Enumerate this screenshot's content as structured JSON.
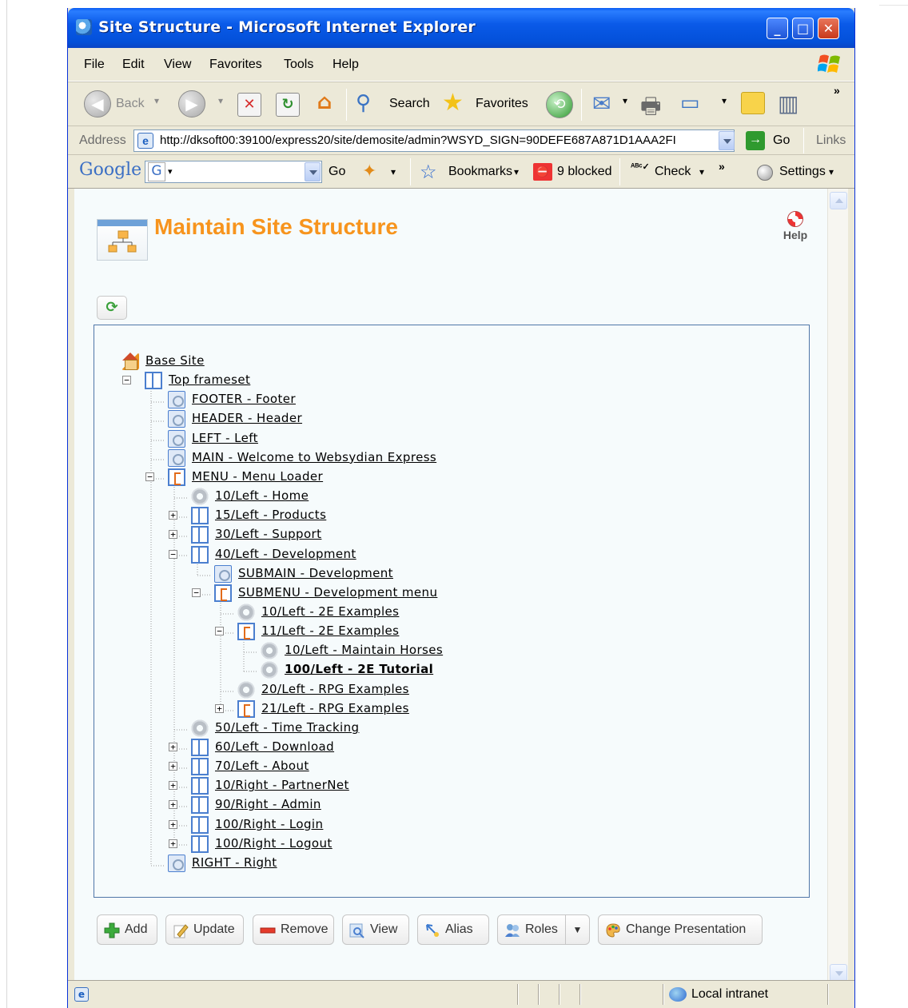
{
  "window": {
    "title": "Site Structure - Microsoft Internet Explorer"
  },
  "menu": [
    "File",
    "Edit",
    "View",
    "Favorites",
    "Tools",
    "Help"
  ],
  "toolbar": {
    "back": "Back",
    "search": "Search",
    "favorites": "Favorites"
  },
  "address": {
    "label": "Address",
    "url": "http://dksoft00:39100/express20/site/demosite/admin?WSYD_SIGN=90DEFE687A871D1AAA2FI",
    "go": "Go",
    "links": "Links"
  },
  "google": {
    "logo": "Google",
    "go": "Go",
    "bookmarks": "Bookmarks",
    "blocked": "9 blocked",
    "check": "Check",
    "settings": "Settings"
  },
  "page": {
    "title": "Maintain Site Structure",
    "help": "Help"
  },
  "tree": [
    {
      "label": "Base Site",
      "icon": "home-icon",
      "depth": 0
    },
    {
      "label": "Top frameset",
      "icon": "frameset-icon",
      "depth": 1,
      "toggle": "−"
    },
    {
      "label": "FOOTER - Footer",
      "icon": "page-icon",
      "depth": 2
    },
    {
      "label": "HEADER - Header",
      "icon": "page-icon",
      "depth": 2
    },
    {
      "label": "LEFT - Left",
      "icon": "page-icon",
      "depth": 2
    },
    {
      "label": "MAIN - Welcome to Websydian Express",
      "icon": "page-icon",
      "depth": 2
    },
    {
      "label": "MENU - Menu Loader",
      "icon": "menu-icon",
      "depth": 2,
      "toggle": "−"
    },
    {
      "label": "10/Left - Home",
      "icon": "gear-icon",
      "depth": 3
    },
    {
      "label": "15/Left - Products",
      "icon": "frameset-icon",
      "depth": 3,
      "toggle": "+"
    },
    {
      "label": "30/Left - Support",
      "icon": "frameset-icon",
      "depth": 3,
      "toggle": "+"
    },
    {
      "label": "40/Left - Development",
      "icon": "frameset-icon",
      "depth": 3,
      "toggle": "−"
    },
    {
      "label": "SUBMAIN - Development",
      "icon": "page-icon",
      "depth": 4
    },
    {
      "label": "SUBMENU - Development menu",
      "icon": "menu-icon",
      "depth": 4,
      "toggle": "−"
    },
    {
      "label": "10/Left - 2E Examples",
      "icon": "gear-icon",
      "depth": 5
    },
    {
      "label": "11/Left - 2E Examples",
      "icon": "menu-icon",
      "depth": 5,
      "toggle": "−"
    },
    {
      "label": "10/Left - Maintain Horses",
      "icon": "gear-icon",
      "depth": 6
    },
    {
      "label": "100/Left - 2E Tutorial",
      "icon": "gear-icon",
      "depth": 6,
      "bold": true
    },
    {
      "label": "20/Left - RPG Examples",
      "icon": "gear-icon",
      "depth": 5
    },
    {
      "label": "21/Left - RPG Examples",
      "icon": "menu-icon",
      "depth": 5,
      "toggle": "+"
    },
    {
      "label": "50/Left - Time Tracking",
      "icon": "gear-icon",
      "depth": 3
    },
    {
      "label": "60/Left - Download",
      "icon": "frameset-icon",
      "depth": 3,
      "toggle": "+"
    },
    {
      "label": "70/Left - About",
      "icon": "frameset-icon",
      "depth": 3,
      "toggle": "+"
    },
    {
      "label": "10/Right - PartnerNet",
      "icon": "frameset-icon",
      "depth": 3,
      "toggle": "+"
    },
    {
      "label": "90/Right - Admin",
      "icon": "frameset-icon",
      "depth": 3,
      "toggle": "+"
    },
    {
      "label": "100/Right - Login",
      "icon": "frameset-icon",
      "depth": 3,
      "toggle": "+"
    },
    {
      "label": "100/Right - Logout",
      "icon": "frameset-icon",
      "depth": 3,
      "toggle": "+"
    },
    {
      "label": "RIGHT - Right",
      "icon": "page-icon",
      "depth": 2
    }
  ],
  "buttons": {
    "add": "Add",
    "update": "Update",
    "remove": "Remove",
    "view": "View",
    "alias": "Alias",
    "roles": "Roles",
    "change_presentation": "Change Presentation"
  },
  "status": {
    "zone": "Local intranet"
  },
  "colors": {
    "title_orange": "#f7941d",
    "xp_blue": "#0350d9",
    "tree_border": "#4f76a8"
  }
}
